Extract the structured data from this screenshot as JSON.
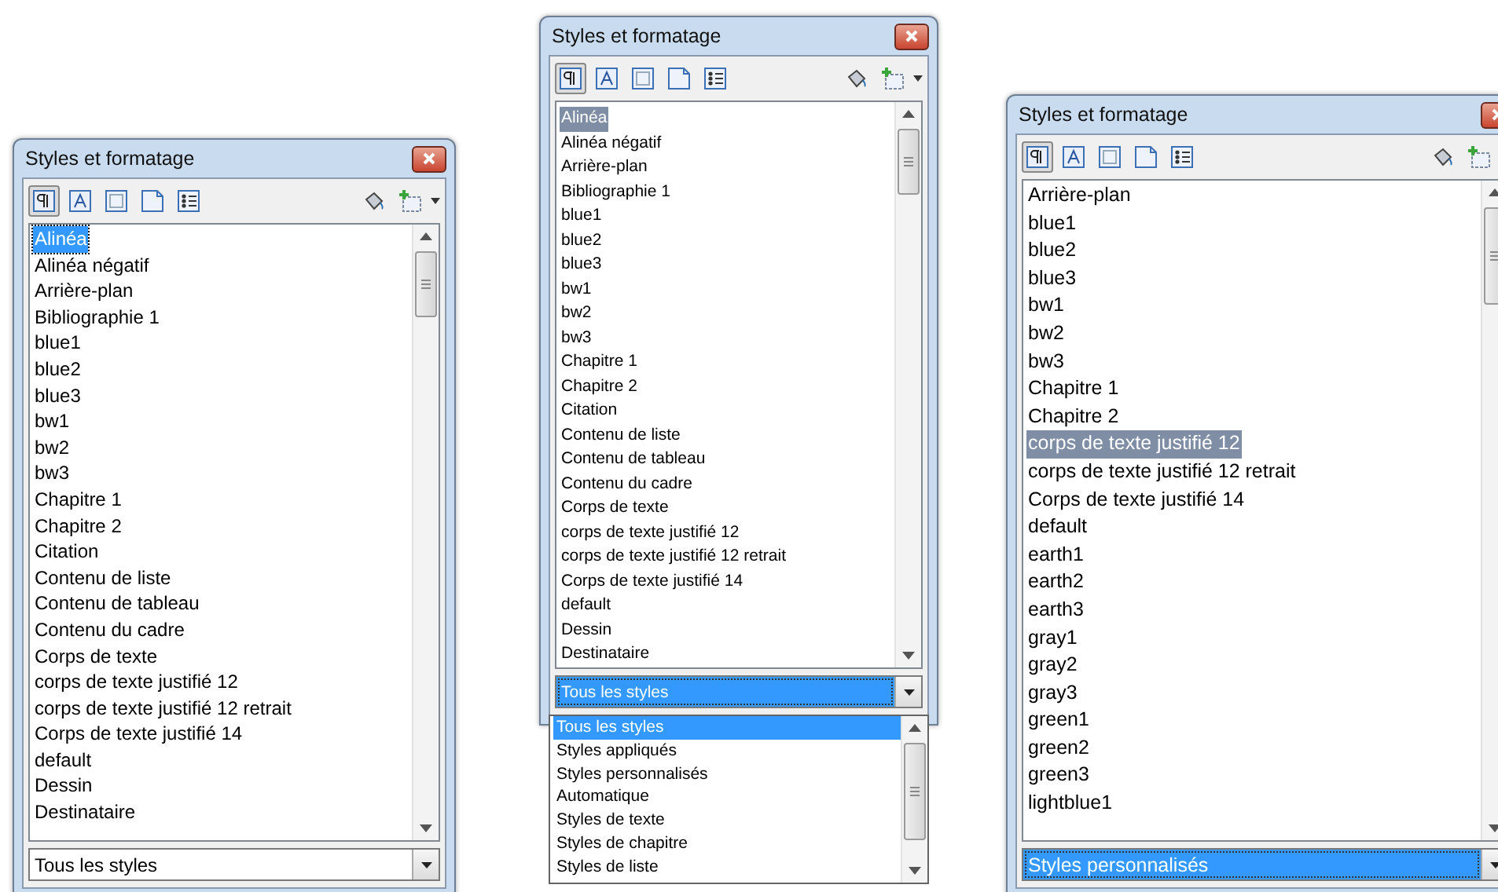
{
  "panels": [
    {
      "title": "Styles et formatage",
      "list_focused": true,
      "items": [
        {
          "label": "Alinéa",
          "selected": true
        },
        {
          "label": "Alinéa négatif",
          "selected": false
        },
        {
          "label": "Arrière-plan",
          "selected": false
        },
        {
          "label": "Bibliographie 1",
          "selected": false
        },
        {
          "label": "blue1",
          "selected": false
        },
        {
          "label": "blue2",
          "selected": false
        },
        {
          "label": "blue3",
          "selected": false
        },
        {
          "label": "bw1",
          "selected": false
        },
        {
          "label": "bw2",
          "selected": false
        },
        {
          "label": "bw3",
          "selected": false
        },
        {
          "label": "Chapitre 1",
          "selected": false
        },
        {
          "label": "Chapitre 2",
          "selected": false
        },
        {
          "label": "Citation",
          "selected": false
        },
        {
          "label": "Contenu de liste",
          "selected": false
        },
        {
          "label": "Contenu de tableau",
          "selected": false
        },
        {
          "label": "Contenu du cadre",
          "selected": false
        },
        {
          "label": "Corps de texte",
          "selected": false
        },
        {
          "label": "corps de texte justifié 12",
          "selected": false
        },
        {
          "label": "corps de texte justifié 12 retrait",
          "selected": false
        },
        {
          "label": "Corps de texte justifié 14",
          "selected": false
        },
        {
          "label": "default",
          "selected": false
        },
        {
          "label": "Dessin",
          "selected": false
        },
        {
          "label": "Destinataire",
          "selected": false
        }
      ],
      "filter": {
        "value": "Tous les styles",
        "highlighted": false
      }
    },
    {
      "title": "Styles et formatage",
      "list_focused": false,
      "items": [
        {
          "label": "Alinéa",
          "selected": true
        },
        {
          "label": "Alinéa négatif",
          "selected": false
        },
        {
          "label": "Arrière-plan",
          "selected": false
        },
        {
          "label": "Bibliographie 1",
          "selected": false
        },
        {
          "label": "blue1",
          "selected": false
        },
        {
          "label": "blue2",
          "selected": false
        },
        {
          "label": "blue3",
          "selected": false
        },
        {
          "label": "bw1",
          "selected": false
        },
        {
          "label": "bw2",
          "selected": false
        },
        {
          "label": "bw3",
          "selected": false
        },
        {
          "label": "Chapitre 1",
          "selected": false
        },
        {
          "label": "Chapitre 2",
          "selected": false
        },
        {
          "label": "Citation",
          "selected": false
        },
        {
          "label": "Contenu de liste",
          "selected": false
        },
        {
          "label": "Contenu de tableau",
          "selected": false
        },
        {
          "label": "Contenu du cadre",
          "selected": false
        },
        {
          "label": "Corps de texte",
          "selected": false
        },
        {
          "label": "corps de texte justifié 12",
          "selected": false
        },
        {
          "label": "corps de texte justifié 12 retrait",
          "selected": false
        },
        {
          "label": "Corps de texte justifié 14",
          "selected": false
        },
        {
          "label": "default",
          "selected": false
        },
        {
          "label": "Dessin",
          "selected": false
        },
        {
          "label": "Destinataire",
          "selected": false
        }
      ],
      "filter": {
        "value": "Tous les styles",
        "highlighted": true,
        "options": [
          {
            "label": "Tous les styles",
            "selected": true
          },
          {
            "label": "Styles appliqués",
            "selected": false
          },
          {
            "label": "Styles personnalisés",
            "selected": false
          },
          {
            "label": "Automatique",
            "selected": false
          },
          {
            "label": "Styles de texte",
            "selected": false
          },
          {
            "label": "Styles de chapitre",
            "selected": false
          },
          {
            "label": "Styles de liste",
            "selected": false
          }
        ]
      }
    },
    {
      "title": "Styles et formatage",
      "list_focused": false,
      "items": [
        {
          "label": "Arrière-plan",
          "selected": false
        },
        {
          "label": "blue1",
          "selected": false
        },
        {
          "label": "blue2",
          "selected": false
        },
        {
          "label": "blue3",
          "selected": false
        },
        {
          "label": "bw1",
          "selected": false
        },
        {
          "label": "bw2",
          "selected": false
        },
        {
          "label": "bw3",
          "selected": false
        },
        {
          "label": "Chapitre 1",
          "selected": false
        },
        {
          "label": "Chapitre 2",
          "selected": false
        },
        {
          "label": "corps de texte justifié 12",
          "selected": true
        },
        {
          "label": "corps de texte justifié 12 retrait",
          "selected": false
        },
        {
          "label": "Corps de texte justifié 14",
          "selected": false
        },
        {
          "label": "default",
          "selected": false
        },
        {
          "label": "earth1",
          "selected": false
        },
        {
          "label": "earth2",
          "selected": false
        },
        {
          "label": "earth3",
          "selected": false
        },
        {
          "label": "gray1",
          "selected": false
        },
        {
          "label": "gray2",
          "selected": false
        },
        {
          "label": "gray3",
          "selected": false
        },
        {
          "label": "green1",
          "selected": false
        },
        {
          "label": "green2",
          "selected": false
        },
        {
          "label": "green3",
          "selected": false
        },
        {
          "label": "lightblue1",
          "selected": false
        }
      ],
      "filter": {
        "value": "Styles personnalisés",
        "highlighted": true
      }
    }
  ]
}
